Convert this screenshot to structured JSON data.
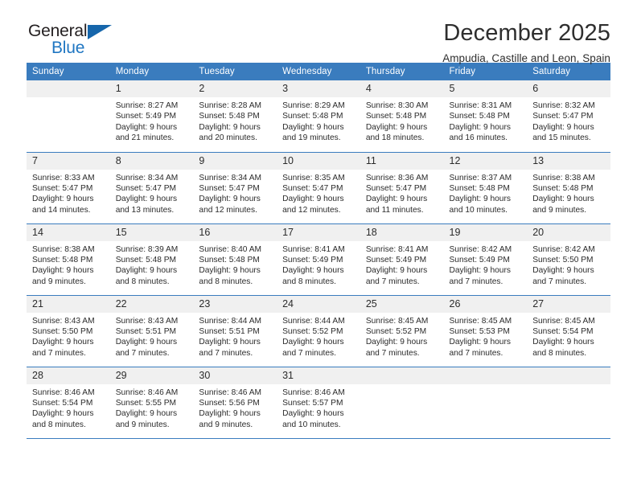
{
  "brand": {
    "name_part1": "General",
    "name_part2": "Blue",
    "accent_color": "#1f76c2",
    "triangle_color": "#1666ab",
    "triangle_icon": "triangle-icon"
  },
  "header": {
    "month_title": "December 2025",
    "location": "Ampudia, Castille and Leon, Spain"
  },
  "calendar": {
    "header_color": "#3a7cbe",
    "weekday_headers": [
      "Sunday",
      "Monday",
      "Tuesday",
      "Wednesday",
      "Thursday",
      "Friday",
      "Saturday"
    ],
    "weeks": [
      [
        {
          "day": "",
          "sunrise": "",
          "sunset": "",
          "daylight_line1": "",
          "daylight_line2": "",
          "empty": true
        },
        {
          "day": "1",
          "sunrise": "Sunrise: 8:27 AM",
          "sunset": "Sunset: 5:49 PM",
          "daylight_line1": "Daylight: 9 hours",
          "daylight_line2": "and 21 minutes."
        },
        {
          "day": "2",
          "sunrise": "Sunrise: 8:28 AM",
          "sunset": "Sunset: 5:48 PM",
          "daylight_line1": "Daylight: 9 hours",
          "daylight_line2": "and 20 minutes."
        },
        {
          "day": "3",
          "sunrise": "Sunrise: 8:29 AM",
          "sunset": "Sunset: 5:48 PM",
          "daylight_line1": "Daylight: 9 hours",
          "daylight_line2": "and 19 minutes."
        },
        {
          "day": "4",
          "sunrise": "Sunrise: 8:30 AM",
          "sunset": "Sunset: 5:48 PM",
          "daylight_line1": "Daylight: 9 hours",
          "daylight_line2": "and 18 minutes."
        },
        {
          "day": "5",
          "sunrise": "Sunrise: 8:31 AM",
          "sunset": "Sunset: 5:48 PM",
          "daylight_line1": "Daylight: 9 hours",
          "daylight_line2": "and 16 minutes."
        },
        {
          "day": "6",
          "sunrise": "Sunrise: 8:32 AM",
          "sunset": "Sunset: 5:47 PM",
          "daylight_line1": "Daylight: 9 hours",
          "daylight_line2": "and 15 minutes."
        }
      ],
      [
        {
          "day": "7",
          "sunrise": "Sunrise: 8:33 AM",
          "sunset": "Sunset: 5:47 PM",
          "daylight_line1": "Daylight: 9 hours",
          "daylight_line2": "and 14 minutes."
        },
        {
          "day": "8",
          "sunrise": "Sunrise: 8:34 AM",
          "sunset": "Sunset: 5:47 PM",
          "daylight_line1": "Daylight: 9 hours",
          "daylight_line2": "and 13 minutes."
        },
        {
          "day": "9",
          "sunrise": "Sunrise: 8:34 AM",
          "sunset": "Sunset: 5:47 PM",
          "daylight_line1": "Daylight: 9 hours",
          "daylight_line2": "and 12 minutes."
        },
        {
          "day": "10",
          "sunrise": "Sunrise: 8:35 AM",
          "sunset": "Sunset: 5:47 PM",
          "daylight_line1": "Daylight: 9 hours",
          "daylight_line2": "and 12 minutes."
        },
        {
          "day": "11",
          "sunrise": "Sunrise: 8:36 AM",
          "sunset": "Sunset: 5:47 PM",
          "daylight_line1": "Daylight: 9 hours",
          "daylight_line2": "and 11 minutes."
        },
        {
          "day": "12",
          "sunrise": "Sunrise: 8:37 AM",
          "sunset": "Sunset: 5:48 PM",
          "daylight_line1": "Daylight: 9 hours",
          "daylight_line2": "and 10 minutes."
        },
        {
          "day": "13",
          "sunrise": "Sunrise: 8:38 AM",
          "sunset": "Sunset: 5:48 PM",
          "daylight_line1": "Daylight: 9 hours",
          "daylight_line2": "and 9 minutes."
        }
      ],
      [
        {
          "day": "14",
          "sunrise": "Sunrise: 8:38 AM",
          "sunset": "Sunset: 5:48 PM",
          "daylight_line1": "Daylight: 9 hours",
          "daylight_line2": "and 9 minutes."
        },
        {
          "day": "15",
          "sunrise": "Sunrise: 8:39 AM",
          "sunset": "Sunset: 5:48 PM",
          "daylight_line1": "Daylight: 9 hours",
          "daylight_line2": "and 8 minutes."
        },
        {
          "day": "16",
          "sunrise": "Sunrise: 8:40 AM",
          "sunset": "Sunset: 5:48 PM",
          "daylight_line1": "Daylight: 9 hours",
          "daylight_line2": "and 8 minutes."
        },
        {
          "day": "17",
          "sunrise": "Sunrise: 8:41 AM",
          "sunset": "Sunset: 5:49 PM",
          "daylight_line1": "Daylight: 9 hours",
          "daylight_line2": "and 8 minutes."
        },
        {
          "day": "18",
          "sunrise": "Sunrise: 8:41 AM",
          "sunset": "Sunset: 5:49 PM",
          "daylight_line1": "Daylight: 9 hours",
          "daylight_line2": "and 7 minutes."
        },
        {
          "day": "19",
          "sunrise": "Sunrise: 8:42 AM",
          "sunset": "Sunset: 5:49 PM",
          "daylight_line1": "Daylight: 9 hours",
          "daylight_line2": "and 7 minutes."
        },
        {
          "day": "20",
          "sunrise": "Sunrise: 8:42 AM",
          "sunset": "Sunset: 5:50 PM",
          "daylight_line1": "Daylight: 9 hours",
          "daylight_line2": "and 7 minutes."
        }
      ],
      [
        {
          "day": "21",
          "sunrise": "Sunrise: 8:43 AM",
          "sunset": "Sunset: 5:50 PM",
          "daylight_line1": "Daylight: 9 hours",
          "daylight_line2": "and 7 minutes."
        },
        {
          "day": "22",
          "sunrise": "Sunrise: 8:43 AM",
          "sunset": "Sunset: 5:51 PM",
          "daylight_line1": "Daylight: 9 hours",
          "daylight_line2": "and 7 minutes."
        },
        {
          "day": "23",
          "sunrise": "Sunrise: 8:44 AM",
          "sunset": "Sunset: 5:51 PM",
          "daylight_line1": "Daylight: 9 hours",
          "daylight_line2": "and 7 minutes."
        },
        {
          "day": "24",
          "sunrise": "Sunrise: 8:44 AM",
          "sunset": "Sunset: 5:52 PM",
          "daylight_line1": "Daylight: 9 hours",
          "daylight_line2": "and 7 minutes."
        },
        {
          "day": "25",
          "sunrise": "Sunrise: 8:45 AM",
          "sunset": "Sunset: 5:52 PM",
          "daylight_line1": "Daylight: 9 hours",
          "daylight_line2": "and 7 minutes."
        },
        {
          "day": "26",
          "sunrise": "Sunrise: 8:45 AM",
          "sunset": "Sunset: 5:53 PM",
          "daylight_line1": "Daylight: 9 hours",
          "daylight_line2": "and 7 minutes."
        },
        {
          "day": "27",
          "sunrise": "Sunrise: 8:45 AM",
          "sunset": "Sunset: 5:54 PM",
          "daylight_line1": "Daylight: 9 hours",
          "daylight_line2": "and 8 minutes."
        }
      ],
      [
        {
          "day": "28",
          "sunrise": "Sunrise: 8:46 AM",
          "sunset": "Sunset: 5:54 PM",
          "daylight_line1": "Daylight: 9 hours",
          "daylight_line2": "and 8 minutes."
        },
        {
          "day": "29",
          "sunrise": "Sunrise: 8:46 AM",
          "sunset": "Sunset: 5:55 PM",
          "daylight_line1": "Daylight: 9 hours",
          "daylight_line2": "and 9 minutes."
        },
        {
          "day": "30",
          "sunrise": "Sunrise: 8:46 AM",
          "sunset": "Sunset: 5:56 PM",
          "daylight_line1": "Daylight: 9 hours",
          "daylight_line2": "and 9 minutes."
        },
        {
          "day": "31",
          "sunrise": "Sunrise: 8:46 AM",
          "sunset": "Sunset: 5:57 PM",
          "daylight_line1": "Daylight: 9 hours",
          "daylight_line2": "and 10 minutes."
        },
        {
          "day": "",
          "sunrise": "",
          "sunset": "",
          "daylight_line1": "",
          "daylight_line2": "",
          "empty": true
        },
        {
          "day": "",
          "sunrise": "",
          "sunset": "",
          "daylight_line1": "",
          "daylight_line2": "",
          "empty": true
        },
        {
          "day": "",
          "sunrise": "",
          "sunset": "",
          "daylight_line1": "",
          "daylight_line2": "",
          "empty": true
        }
      ]
    ]
  }
}
